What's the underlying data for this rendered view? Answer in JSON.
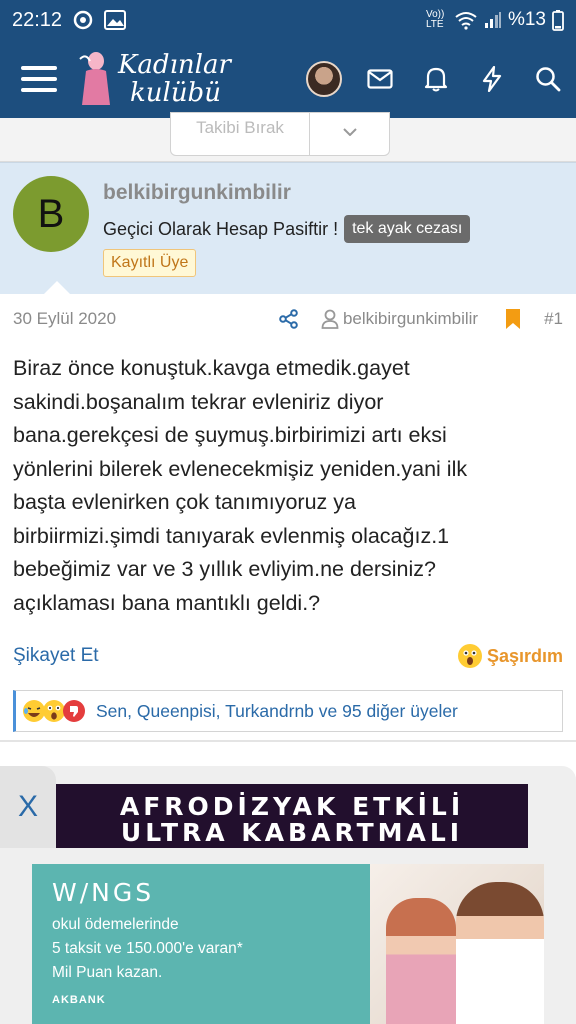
{
  "status_bar": {
    "time": "22:12",
    "network": "Vo)) LTE",
    "battery": "%13"
  },
  "header": {
    "logo_line1": "Kadınlar",
    "logo_line2": "kulübü",
    "icons": [
      "menu-icon",
      "avatar",
      "mail-icon",
      "bell-icon",
      "bolt-icon",
      "search-icon"
    ]
  },
  "follow": {
    "label": "Takibi Bırak"
  },
  "post": {
    "author_initial": "B",
    "username": "belkibirgunkimbilir",
    "status_text": "Geçici Olarak Hesap Pasiftir !",
    "penalty_badge": "tek ayak cezası",
    "member_badge": "Kayıtlı Üye",
    "date": "30 Eylül 2020",
    "meta_author": "belkibirgunkimbilir",
    "post_number": "#1",
    "body_lines": [
      "Biraz önce konuştuk.kavga etmedik.gayet",
      "sakindi.boşanalım tekrar evleniriz diyor",
      "bana.gerekçesi de şuymuş.birbirimizi artı eksi",
      "yönlerini bilerek evlenecekmişiz yeniden.yani ilk",
      "başta evlenirken çok tanımıyoruz ya",
      "birbiirmizi.şimdi tanıyarak evlenmiş olacağız.1",
      "bebeğimiz var ve 3 yıllık evliyim.ne dersiniz?",
      "açıklaması bana mantıklı geldi.?"
    ],
    "report_label": "Şikayet Et",
    "react_label": "Şaşırdım",
    "reactions_text": "Sen, Queenpisi, Turkandrnb ve 95 diğer üyeler"
  },
  "ads": {
    "close_label": "X",
    "banner_line1": "AFRODİZYAK ETKİLİ",
    "banner_line2": "ULTRA KABARTMALI",
    "main_brand": "W/NGS",
    "main_line1": "okul ödemelerinde",
    "main_line2": "5 taksit ve 150.000'e varan*",
    "main_line3": "Mil Puan kazan.",
    "main_bank": "AKBANK"
  },
  "colors": {
    "header_bg": "#1d4e7e",
    "card_bg": "#dce9f5",
    "link": "#2a6aa8",
    "accent_orange": "#e8962c",
    "avatar_green": "#7c9b2f"
  }
}
